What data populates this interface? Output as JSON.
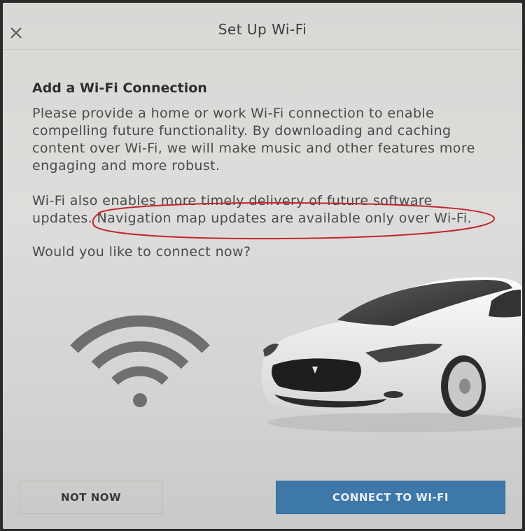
{
  "window": {
    "title": "Set Up Wi-Fi"
  },
  "content": {
    "heading": "Add a Wi-Fi Connection",
    "paragraph1": "Please provide a home or work Wi-Fi connection to enable compelling future functionality. By downloading and caching content over Wi-Fi, we will make music and other features more engaging and more robust.",
    "paragraph2": "Wi-Fi also enables more timely delivery of future software updates. Navigation map updates are available only over Wi-Fi.",
    "paragraph3": "Would you like to connect now?"
  },
  "buttons": {
    "not_now": "NOT NOW",
    "connect": "CONNECT TO WI-FI"
  },
  "icons": {
    "close": "close-icon",
    "wifi": "wifi-icon"
  },
  "colors": {
    "accent": "#3d78a8",
    "annotation": "#c0262a"
  }
}
